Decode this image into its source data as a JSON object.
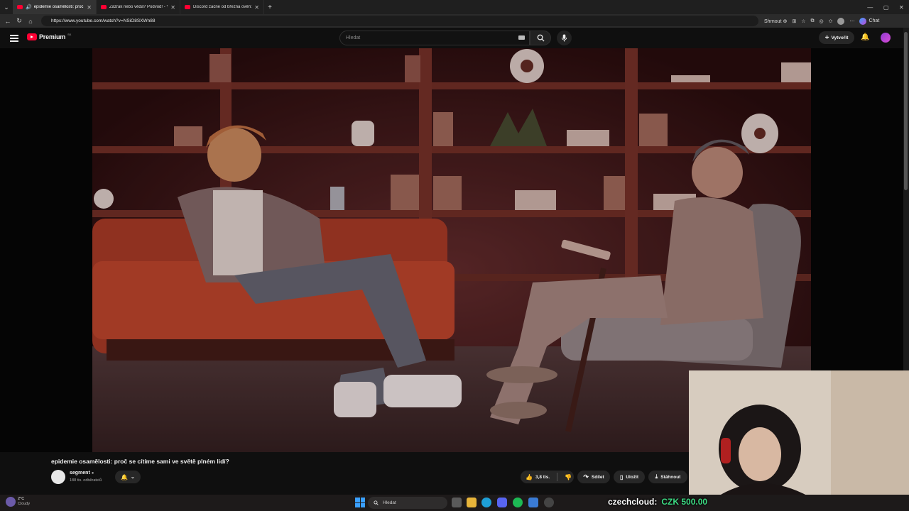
{
  "browser": {
    "tabs": [
      {
        "label": "epidemie osamělosti: proč se c",
        "active": true
      },
      {
        "label": "Zázrak nebo věda? Podvod! - You",
        "active": false
      },
      {
        "label": "Discord začne od března ověřova",
        "active": false
      }
    ],
    "new_tab": "+",
    "url": "https://www.youtube.com/watch?v=NSiO8SXWn88",
    "summary_label": "Shrnout",
    "chat_label": "Chat"
  },
  "youtube": {
    "logo_text": "Premium",
    "logo_region": "SK",
    "search_placeholder": "Hledat",
    "create_label": "Vytvořit"
  },
  "video": {
    "title": "epidemie osamělosti: proč se cítíme sami ve světě plném lidí?",
    "channel": "segment",
    "subscribers": "188 tis. odběratelů",
    "likes": "3,8 tis.",
    "share_label": "Sdílet",
    "save_label": "Uložit",
    "download_label": "Stáhnout"
  },
  "taskbar": {
    "temperature": "2°C",
    "weather": "Cloudy",
    "search_label": "Hledat"
  },
  "stream_overlay": {
    "donor": "czechcloud:",
    "amount": "CZK 500.00"
  },
  "colors": {
    "yt_red": "#ff0033",
    "overlay_green": "#3ddc84"
  }
}
